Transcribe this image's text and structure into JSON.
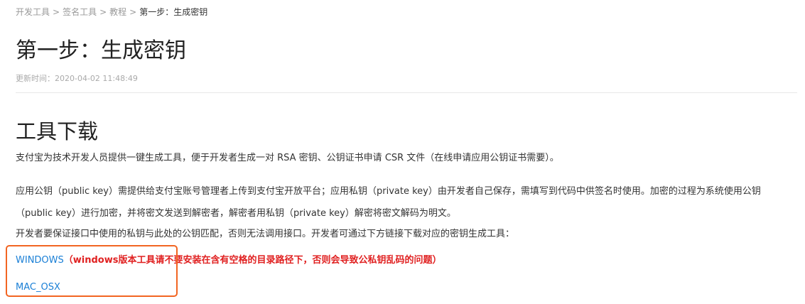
{
  "breadcrumb": {
    "items": [
      "开发工具",
      "签名工具",
      "教程"
    ],
    "current": "第一步：生成密钥",
    "separator": ">"
  },
  "page": {
    "title": "第一步：生成密钥",
    "update_time": "更新时间：2020-04-02 11:48:49"
  },
  "section": {
    "title": "工具下载",
    "paragraphs": [
      "支付宝为技术开发人员提供一键生成工具，便于开发者生成一对 RSA 密钥、公钥证书申请 CSR 文件（在线申请应用公钥证书需要）。",
      "应用公钥（public key）需提供给支付宝账号管理者上传到支付宝开放平台；应用私钥（private key）由开发者自己保存，需填写到代码中供签名时使用。加密的过程为系统使用公钥（public key）进行加密，并将密文发送到解密者，解密者用私钥（private key）解密将密文解码为明文。",
      "开发者要保证接口中使用的私钥与此处的公钥匹配，否则无法调用接口。开发者可通过下方链接下载对应的密钥生成工具："
    ]
  },
  "downloads": {
    "windows_label": "WINDOWS",
    "windows_note": "（windows版本工具请不要安装在含有空格的目录路径下，否则会导致公私钥乱码的问题）",
    "mac_label": "MAC_OSX"
  },
  "colors": {
    "link": "#1a7fd6",
    "warning": "#e02020",
    "highlight_border": "#f26522"
  }
}
